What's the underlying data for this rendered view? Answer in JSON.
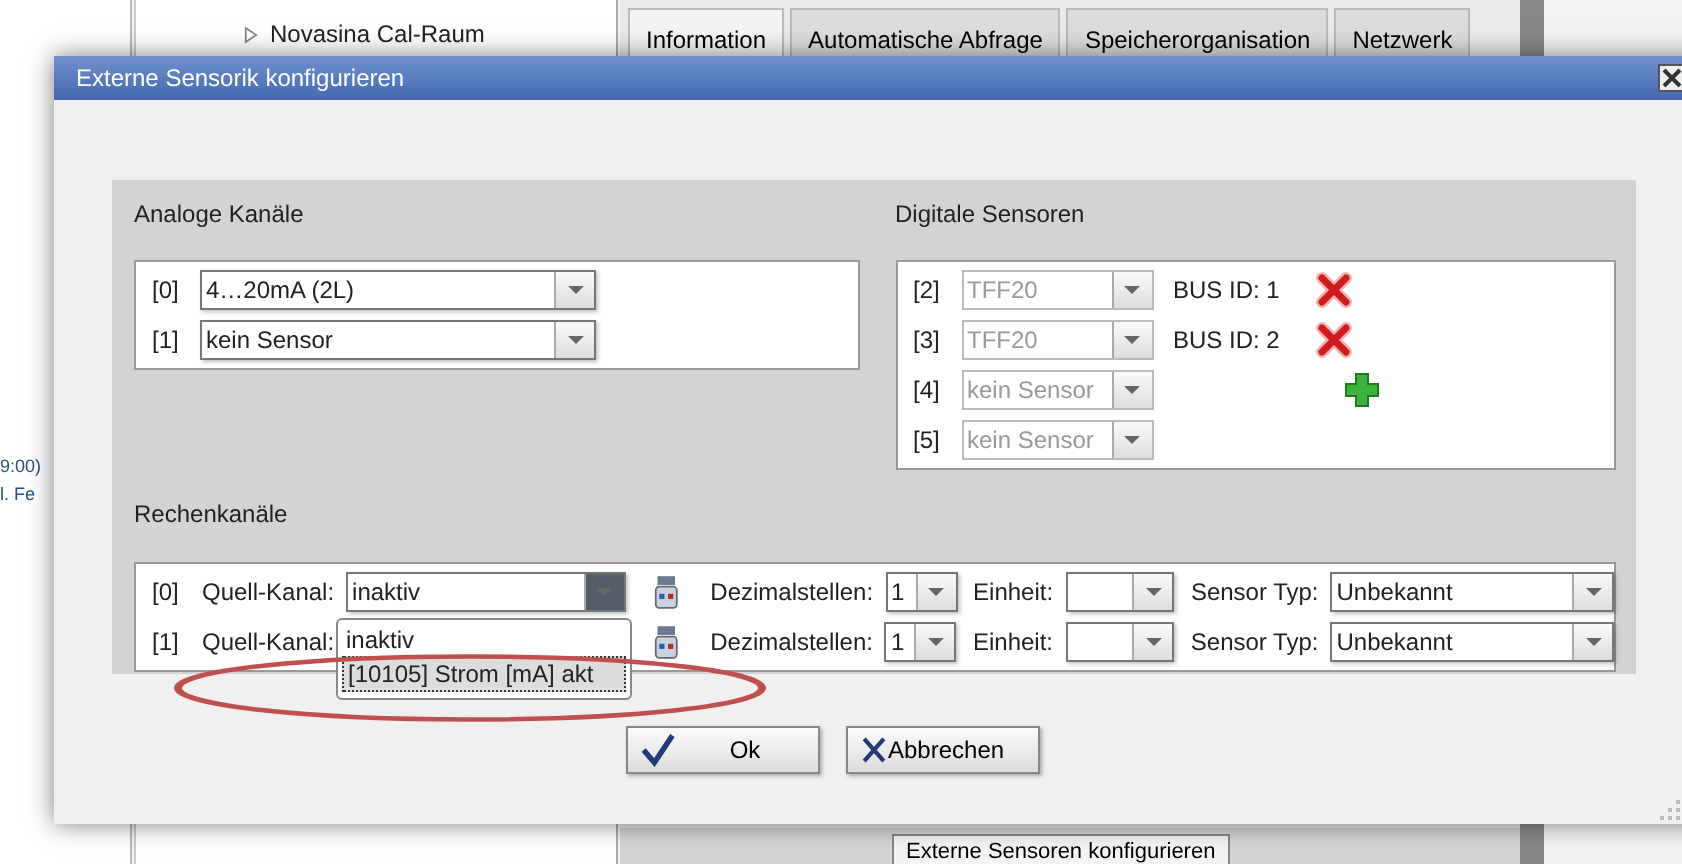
{
  "background": {
    "tree_item": "Novasina Cal-Raum",
    "tabs": [
      {
        "label": "Information",
        "selected": true
      },
      {
        "label": "Automatische Abfrage",
        "selected": false
      },
      {
        "label": "Speicherorganisation",
        "selected": false
      },
      {
        "label": "Netzwerk",
        "selected": false
      }
    ],
    "side_texts": [
      "9:00)",
      "l. Fe"
    ],
    "button": "Externe Sensoren konfigurieren"
  },
  "dialog": {
    "title": "Externe Sensorik konfigurieren",
    "analog": {
      "title": "Analoge Kanäle",
      "channels": [
        {
          "index": "[0]",
          "value": "4…20mA (2L)"
        },
        {
          "index": "[1]",
          "value": "kein Sensor"
        }
      ]
    },
    "digital": {
      "title": "Digitale Sensoren",
      "sensors": [
        {
          "index": "[2]",
          "value": "TFF20",
          "disabled": true,
          "bus_id": "BUS ID: 1",
          "removable": true
        },
        {
          "index": "[3]",
          "value": "TFF20",
          "disabled": true,
          "bus_id": "BUS ID: 2",
          "removable": true
        },
        {
          "index": "[4]",
          "value": "kein Sensor",
          "disabled": true,
          "addable": true
        },
        {
          "index": "[5]",
          "value": "kein Sensor",
          "disabled": true
        }
      ]
    },
    "compute": {
      "title": "Rechenkanäle",
      "channels": [
        {
          "index": "[0]",
          "source_label": "Quell-Kanal:",
          "source": "inaktiv",
          "open": true,
          "decimals_label": "Dezimalstellen:",
          "decimals": "1",
          "unit_label": "Einheit:",
          "type_label": "Sensor Typ:",
          "type": "Unbekannt"
        },
        {
          "index": "[1]",
          "source_label": "Quell-Kanal:",
          "decimals_label": "Dezimalstellen:",
          "decimals": "1",
          "unit_label": "Einheit:",
          "type_label": "Sensor Typ:",
          "type": "Unbekannt"
        }
      ]
    },
    "dropdown": {
      "options": [
        {
          "label": "inaktiv",
          "selected": false
        },
        {
          "label": "[10105] Strom [mA] akt",
          "selected": true
        }
      ]
    },
    "buttons": [
      {
        "label": "Ok",
        "kind": "ok"
      },
      {
        "label": "Abbrechen",
        "kind": "cancel"
      }
    ]
  }
}
